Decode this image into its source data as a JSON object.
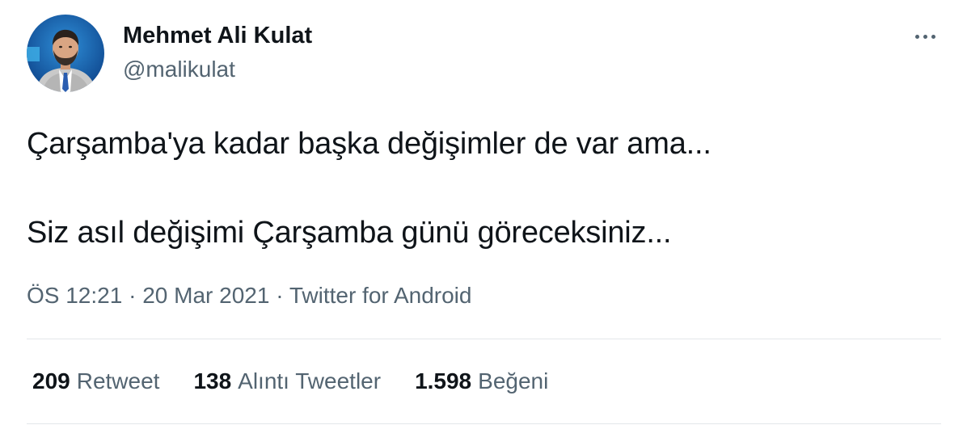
{
  "author": {
    "display_name": "Mehmet Ali Kulat",
    "handle": "@malikulat"
  },
  "tweet": {
    "text_line1": "Çarşamba'ya kadar başka değişimler de var ama...",
    "text_line2": "Siz asıl değişimi Çarşamba günü göreceksiniz..."
  },
  "meta": {
    "time": "ÖS 12:21",
    "separator": "·",
    "date": "20 Mar 2021",
    "source": "Twitter for Android"
  },
  "stats": {
    "retweets_count": "209",
    "retweets_label": "Retweet",
    "quotes_count": "138",
    "quotes_label": "Alıntı Tweetler",
    "likes_count": "1.598",
    "likes_label": "Beğeni"
  },
  "icons": {
    "more": "more-horizontal-icon"
  },
  "colors": {
    "primary_text": "#0f1419",
    "secondary_text": "#536471",
    "divider": "#e3e7ea"
  }
}
